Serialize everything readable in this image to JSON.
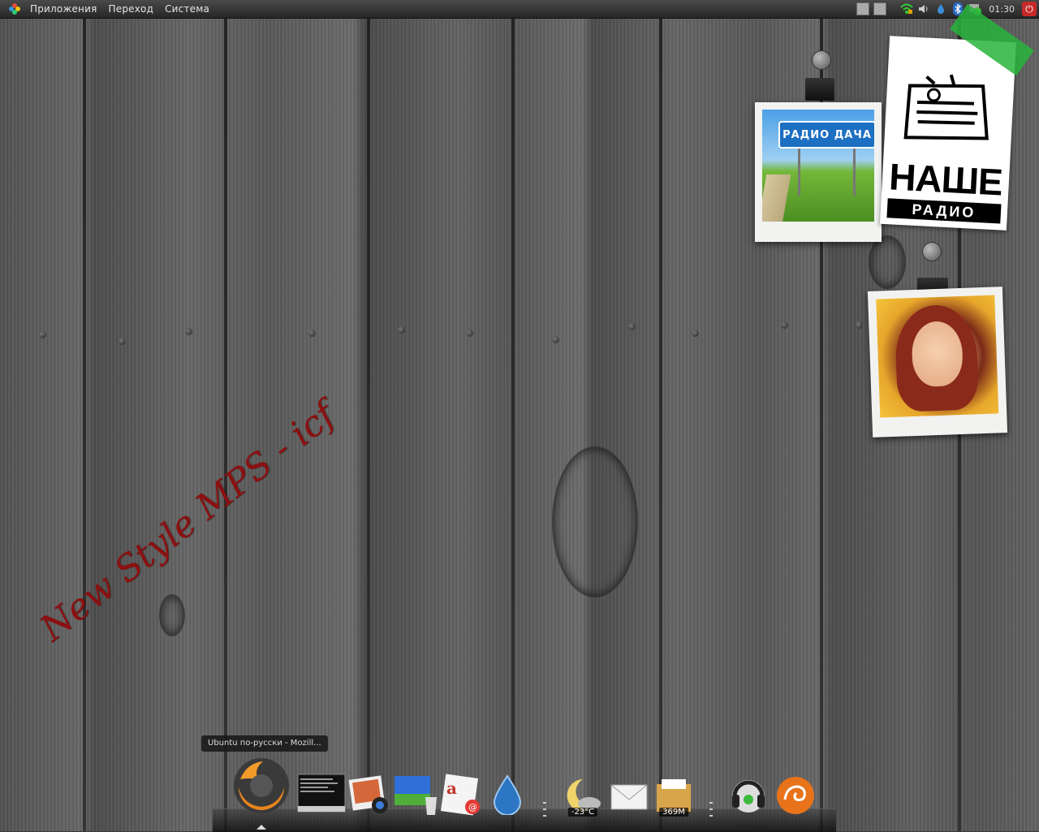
{
  "top_panel": {
    "menu": [
      "Приложения",
      "Переход",
      "Система"
    ],
    "clock": "01:30"
  },
  "desktop": {
    "photo1_sign": "РАДИО ДАЧА",
    "logo_line1": "НАШЕ",
    "logo_line2": "РАДИО",
    "signature": "New Style MPS - icf"
  },
  "tooltip": "Ubuntu по-русски - Mozill...",
  "dock": {
    "weather_temp": "-23°C",
    "archive_size": "369M"
  }
}
